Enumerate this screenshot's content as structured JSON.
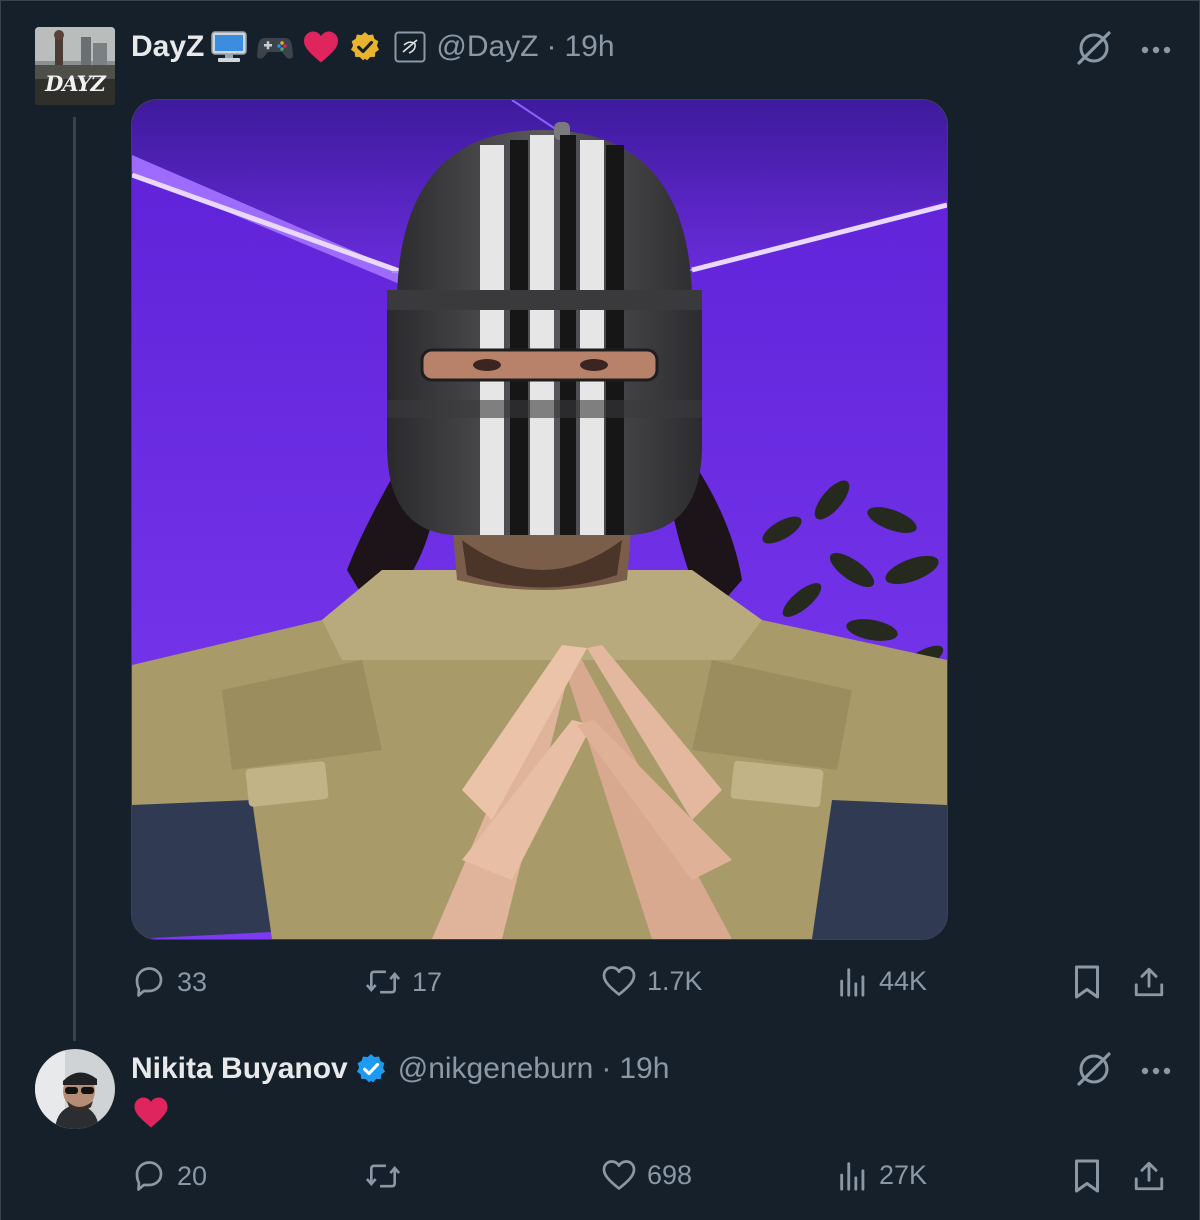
{
  "tweet1": {
    "name": "DayZ",
    "handle": "@DayZ",
    "separator": "·",
    "time": "19h",
    "avatar_text": "DAYZ",
    "badges": [
      "desktop-computer-emoji",
      "game-controller-emoji",
      "red-heart-emoji",
      "gold-verified-badge",
      "affiliate-badge"
    ],
    "stats": {
      "replies": "33",
      "reposts": "17",
      "likes": "1.7K",
      "views": "44K"
    }
  },
  "tweet2": {
    "name": "Nikita Buyanov",
    "handle": "@nikgeneburn",
    "separator": "·",
    "time": "19h",
    "body_emoji": "red-heart-emoji",
    "badges": [
      "blue-verified-badge"
    ],
    "stats": {
      "replies": "20",
      "reposts": "",
      "likes": "698",
      "views": "27K"
    }
  },
  "ui": {
    "more": "···"
  },
  "colors": {
    "background": "#15202b",
    "border": "#38444d",
    "text_primary": "#e7e9ea",
    "text_secondary": "#8b98a5",
    "heart_red": "#e0245e",
    "verified_blue": "#1d9bf0",
    "verified_gold": "#e8b430",
    "wall_purple": "#6b2fe0"
  }
}
